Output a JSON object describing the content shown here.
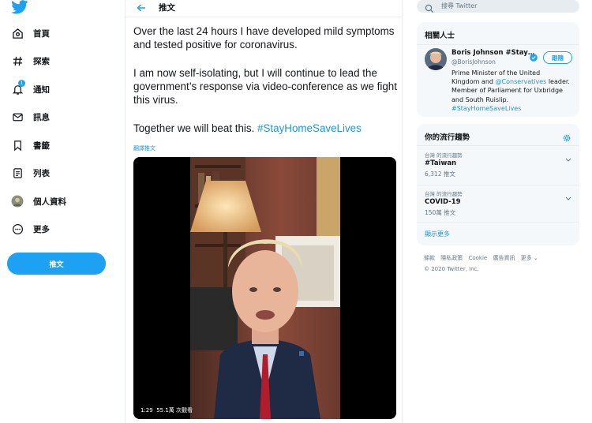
{
  "nav": {
    "items": [
      {
        "label": "首頁",
        "icon": "home-icon"
      },
      {
        "label": "探索",
        "icon": "hashtag-icon"
      },
      {
        "label": "通知",
        "icon": "bell-icon",
        "badge": "1"
      },
      {
        "label": "訊息",
        "icon": "mail-icon"
      },
      {
        "label": "書籤",
        "icon": "bookmark-icon"
      },
      {
        "label": "列表",
        "icon": "list-icon"
      },
      {
        "label": "個人資料",
        "icon": "avatar-icon"
      },
      {
        "label": "更多",
        "icon": "more-icon"
      }
    ],
    "tweet_button": "推文"
  },
  "header": {
    "title": "推文"
  },
  "tweet": {
    "p1": "Over the last 24 hours I have developed mild symptoms and tested positive for coronavirus.",
    "p2": "I am now self-isolating, but I will continue to lead the government’s response via video-conference as we fight this virus.",
    "p3_text": "Together we will beat this. ",
    "p3_hashtag": "#StayHomeSaveLives",
    "translate": "翻譯推文",
    "video_duration": "1:29",
    "video_views": "55.1萬 次觀看"
  },
  "search": {
    "placeholder": "搜尋 Twitter"
  },
  "related": {
    "title": "相關人士",
    "name": "Boris Johnson #Stay…",
    "handle": "@BorisJohnson",
    "follow": "跟隨",
    "bio_1": "Prime Minister of the United Kingdom and ",
    "bio_link1": "@Conservatives",
    "bio_2": " leader. Member of Parliament for Uxbridge and South Ruislip. ",
    "bio_link2": "#StayHomeSaveLives"
  },
  "trends": {
    "title": "你的流行趨勢",
    "items": [
      {
        "context": "台灣 的流行趨勢",
        "name": "#Taiwan",
        "count": "6,312 推文"
      },
      {
        "context": "台灣 的流行趨勢",
        "name": "COVID-19",
        "count": "150萬 推文"
      }
    ],
    "show_more": "顯示更多"
  },
  "footer": {
    "links": [
      "條款",
      "隱私政策",
      "Cookie",
      "廣告資訊",
      "更多 ⌄"
    ],
    "copyright": "© 2020 Twitter, Inc."
  },
  "colors": {
    "brand": "#1da1f2",
    "link": "#1b95e0",
    "text": "#14171a",
    "muted": "#657786"
  }
}
